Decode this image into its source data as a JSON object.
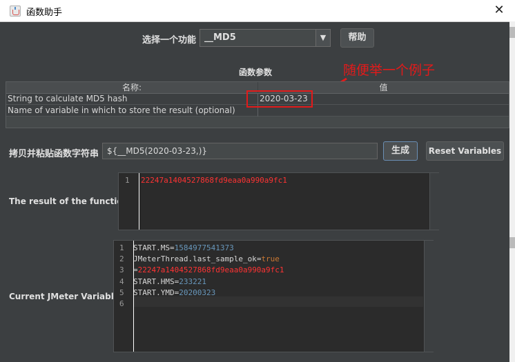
{
  "window": {
    "title": "函数助手",
    "close_glyph": "✕"
  },
  "function_select": {
    "label": "选择一个功能",
    "value": "__MD5",
    "help_button": "帮助"
  },
  "params": {
    "title": "函数参数",
    "columns": [
      "名称:",
      "值"
    ],
    "rows": [
      {
        "name": "String to calculate MD5 hash",
        "value": "2020-03-23"
      },
      {
        "name": "Name of variable in which to store the result (optional)",
        "value": ""
      }
    ]
  },
  "annotation": {
    "text": "随便举一个例子",
    "color": "#e31a1a"
  },
  "copy_row": {
    "label": "拷贝并粘贴函数字符串",
    "value": "${__MD5(2020-03-23,)}",
    "generate_button": "生成",
    "reset_button": "Reset Variables"
  },
  "result": {
    "label": "The result of the function is",
    "lines": [
      {
        "no": "1",
        "text": "22247a1404527868fd9eaa0a990a9fc1"
      }
    ]
  },
  "variables": {
    "label": "Current JMeter Variables",
    "lines": [
      {
        "no": "1",
        "key": "START.MS",
        "eq": "=",
        "val": "1584977541373",
        "type": "num"
      },
      {
        "no": "2",
        "key": "JMeterThread.last_sample_ok",
        "eq": "=",
        "val": "true",
        "type": "bool"
      },
      {
        "no": "3",
        "key": "",
        "eq": "=",
        "val": "22247a1404527868fd9eaa0a990a9fc1",
        "type": "str"
      },
      {
        "no": "4",
        "key": "START.HMS",
        "eq": "=",
        "val": "233221",
        "type": "num"
      },
      {
        "no": "5",
        "key": "START.YMD",
        "eq": "=",
        "val": "20200323",
        "type": "num"
      },
      {
        "no": "6",
        "key": "",
        "eq": "",
        "val": "",
        "type": "none"
      }
    ]
  },
  "colors": {
    "key": "#d8d8d8",
    "num": "#6897bb",
    "bool": "#cc7832",
    "str": "#ff3333"
  }
}
